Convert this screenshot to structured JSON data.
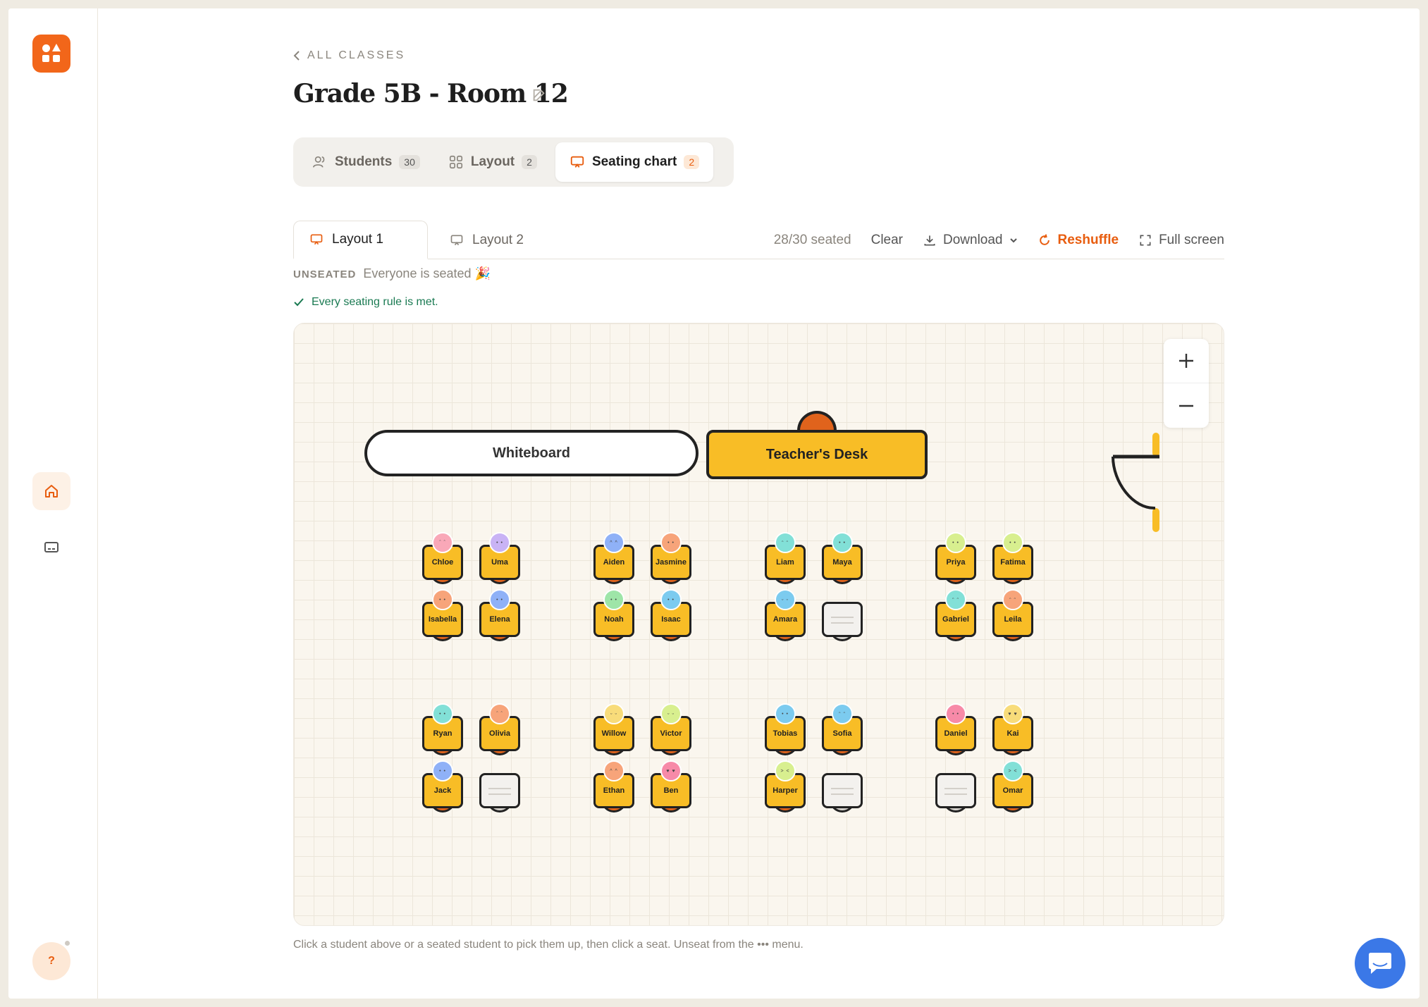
{
  "nav": {
    "back_label": "ALL CLASSES",
    "help_label": "?"
  },
  "page": {
    "title": "Grade 5B - Room 12"
  },
  "tabs": [
    {
      "label": "Students",
      "count": "30"
    },
    {
      "label": "Layout",
      "count": "2"
    },
    {
      "label": "Seating chart",
      "count": "2"
    }
  ],
  "subtabs": [
    {
      "label": "Layout 1"
    },
    {
      "label": "Layout 2"
    }
  ],
  "toolbar": {
    "seated_count": "28/30 seated",
    "clear": "Clear",
    "download": "Download",
    "reshuffle": "Reshuffle",
    "fullscreen": "Full screen"
  },
  "status": {
    "unseated_label": "UNSEATED",
    "unseated_text": "Everyone is seated 🎉",
    "rule_text": "Every seating rule is met."
  },
  "room": {
    "whiteboard": "Whiteboard",
    "teacher_desk": "Teacher's Desk"
  },
  "seats": [
    {
      "name": "Chloe",
      "color": "#f9a8b8",
      "face": "ˆ ˆ"
    },
    {
      "name": "Uma",
      "color": "#c9b3f5",
      "face": "• •"
    },
    {
      "name": "Isabella",
      "color": "#f7a47a",
      "face": "• •"
    },
    {
      "name": "Elena",
      "color": "#8fb1f7",
      "face": "• •"
    },
    {
      "name": "Aiden",
      "color": "#8fb1f7",
      "face": "^ ^"
    },
    {
      "name": "Jasmine",
      "color": "#f7a47a",
      "face": "• •"
    },
    {
      "name": "Noah",
      "color": "#9ee5a8",
      "face": "• •"
    },
    {
      "name": "Isaac",
      "color": "#7ccbef",
      "face": "• •"
    },
    {
      "name": "Liam",
      "color": "#82e0d7",
      "face": "ᵔ ᵔ"
    },
    {
      "name": "Maya",
      "color": "#82e0d7",
      "face": "• •"
    },
    {
      "name": "Amara",
      "color": "#7ccbef",
      "face": "ᵕ ᵕ"
    },
    {
      "name": "",
      "color": "",
      "face": ""
    },
    {
      "name": "Priya",
      "color": "#d8ef8f",
      "face": "• •"
    },
    {
      "name": "Fatima",
      "color": "#d8ef8f",
      "face": "• •"
    },
    {
      "name": "Gabriel",
      "color": "#82e0d7",
      "face": "ᵔ ᵔ"
    },
    {
      "name": "Leila",
      "color": "#f7a47a",
      "face": "ᵔ ᵔ"
    },
    {
      "name": "Ryan",
      "color": "#82e0d7",
      "face": "• •"
    },
    {
      "name": "Olivia",
      "color": "#f7a47a",
      "face": "ˆ ˆ"
    },
    {
      "name": "Jack",
      "color": "#8fb1f7",
      "face": "• •"
    },
    {
      "name": "",
      "color": "",
      "face": ""
    },
    {
      "name": "Willow",
      "color": "#f8dc7a",
      "face": "ᵕ ᵕ"
    },
    {
      "name": "Victor",
      "color": "#d8ef8f",
      "face": "ᵕ ᵕ"
    },
    {
      "name": "Ethan",
      "color": "#f7a47a",
      "face": "^ ^"
    },
    {
      "name": "Ben",
      "color": "#f78aa8",
      "face": "♥ ♥"
    },
    {
      "name": "Tobias",
      "color": "#7ccbef",
      "face": "• •"
    },
    {
      "name": "Sofia",
      "color": "#7ccbef",
      "face": "ᵔ ᵔ"
    },
    {
      "name": "Harper",
      "color": "#d8ef8f",
      "face": "> <"
    },
    {
      "name": "",
      "color": "",
      "face": ""
    },
    {
      "name": "Daniel",
      "color": "#f78aa8",
      "face": "• •"
    },
    {
      "name": "Kai",
      "color": "#f8dc7a",
      "face": "♥ ♥"
    },
    {
      "name": "",
      "color": "",
      "face": ""
    },
    {
      "name": "Omar",
      "color": "#82e0d7",
      "face": "> <"
    }
  ],
  "hint": "Click a student above or a seated student to pick them up, then click a seat. Unseat from the ••• menu.",
  "colors": {
    "accent": "#e85d0f",
    "desk": "#f8bd26",
    "chair": "#e0631c",
    "success": "#1a7a52",
    "chat": "#3b78e7"
  }
}
